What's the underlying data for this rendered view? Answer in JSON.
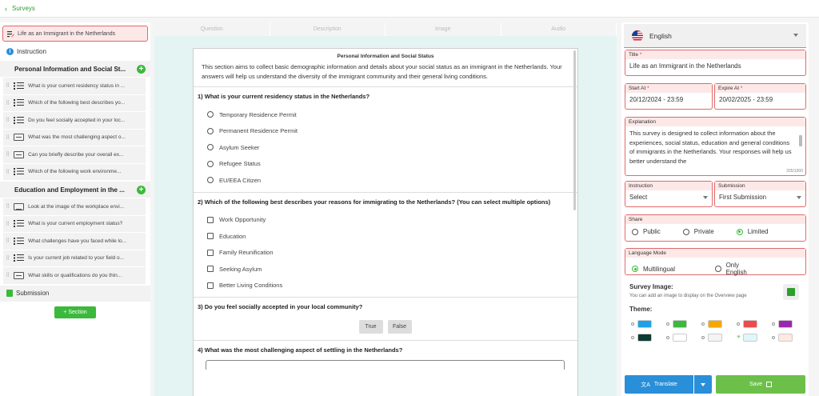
{
  "header": {
    "back_label": "Surveys"
  },
  "left_panel": {
    "survey_title": "Life as an Immigrant in the Netherlands",
    "instruction_label": "Instruction",
    "sections": [
      {
        "title": "Personal Information and Social St...",
        "items": [
          {
            "type": "list",
            "label": "What is your current residency status in ..."
          },
          {
            "type": "list",
            "label": "Which of the following best describes yo..."
          },
          {
            "type": "list",
            "label": "Do you feel socially accepted in your loc..."
          },
          {
            "type": "text",
            "label": "What was the most challenging aspect o..."
          },
          {
            "type": "text",
            "label": "Can you briefly describe your overall ex..."
          },
          {
            "type": "list",
            "label": "Which of the following work environme..."
          }
        ]
      },
      {
        "title": "Education and Employment in the ...",
        "items": [
          {
            "type": "img",
            "label": "Look at the image of the workplace envi..."
          },
          {
            "type": "list",
            "label": "What is your current employment status?"
          },
          {
            "type": "list",
            "label": "What challenges have you faced while lo..."
          },
          {
            "type": "list",
            "label": "Is your current job related to your field o..."
          },
          {
            "type": "text",
            "label": "What skills or qualifications do you thin..."
          }
        ]
      }
    ],
    "submission_label": "Submission",
    "add_section_label": "+ Section"
  },
  "tabs": [
    "Question",
    "Description",
    "Image",
    "Audio"
  ],
  "preview": {
    "section_title": "Personal Information and Social Status",
    "section_desc": "This section aims to collect basic demographic information and details about your social status as an immigrant in the Netherlands. Your answers will help us understand the diversity of the immigrant community and their general living conditions.",
    "q1": {
      "title": "1) What is your current residency status in the Netherlands?",
      "options": [
        "Temporary Residence Permit",
        "Permanent Residence Permit",
        "Asylum Seeker",
        "Refugee Status",
        "EU/EEA Citizen"
      ]
    },
    "q2": {
      "title": "2) Which of the following best describes your reasons for immigrating to the Netherlands? (You can select multiple options)",
      "options": [
        "Work Opportunity",
        "Education",
        "Family Reunification",
        "Seeking Asylum",
        "Better Living Conditions"
      ]
    },
    "q3": {
      "title": "3) Do you feel socially accepted in your local community?",
      "true_label": "True",
      "false_label": "False"
    },
    "q4": {
      "title": "4) What was the most challenging aspect of settling in the Netherlands?"
    }
  },
  "settings": {
    "language": "English",
    "title_label": "Title",
    "title_value": "Life as an Immigrant in the Netherlands",
    "start_label": "Start At",
    "start_value": "20/12/2024 - 23:59",
    "expire_label": "Expire At",
    "expire_value": "20/02/2025 - 23:59",
    "explanation_label": "Explanation",
    "explanation_value": "This survey is designed to collect information about the experiences, social status, education and general conditions of immigrants in the Netherlands. Your responses will help us better understand the",
    "explanation_counter": "335/1000",
    "instruction_label": "Instruction",
    "instruction_value": "Select",
    "submission_label": "Submission",
    "submission_value": "First Submission",
    "share_label": "Share",
    "share_options": [
      "Public",
      "Private",
      "Limited"
    ],
    "share_selected": "Limited",
    "language_mode_label": "Language Mode",
    "language_mode_options": [
      "Multilingual",
      "Only English"
    ],
    "language_mode_selected": "Multilingual",
    "survey_image_label": "Survey Image:",
    "survey_image_hint": "You can add an image to display on the Overview page",
    "theme_label": "Theme:",
    "theme_colors_row1": [
      "#1ea1e8",
      "#3cb93c",
      "#f5a800",
      "#ef4a4a",
      "#9c27b0"
    ],
    "theme_colors_row2": [
      "#0c3b33",
      "#ffffff",
      "#f4f4f4",
      "#e0f6fb",
      "#fde9e2"
    ],
    "theme_selected_index": 8,
    "translate_label": "Translate",
    "save_label": "Save"
  }
}
